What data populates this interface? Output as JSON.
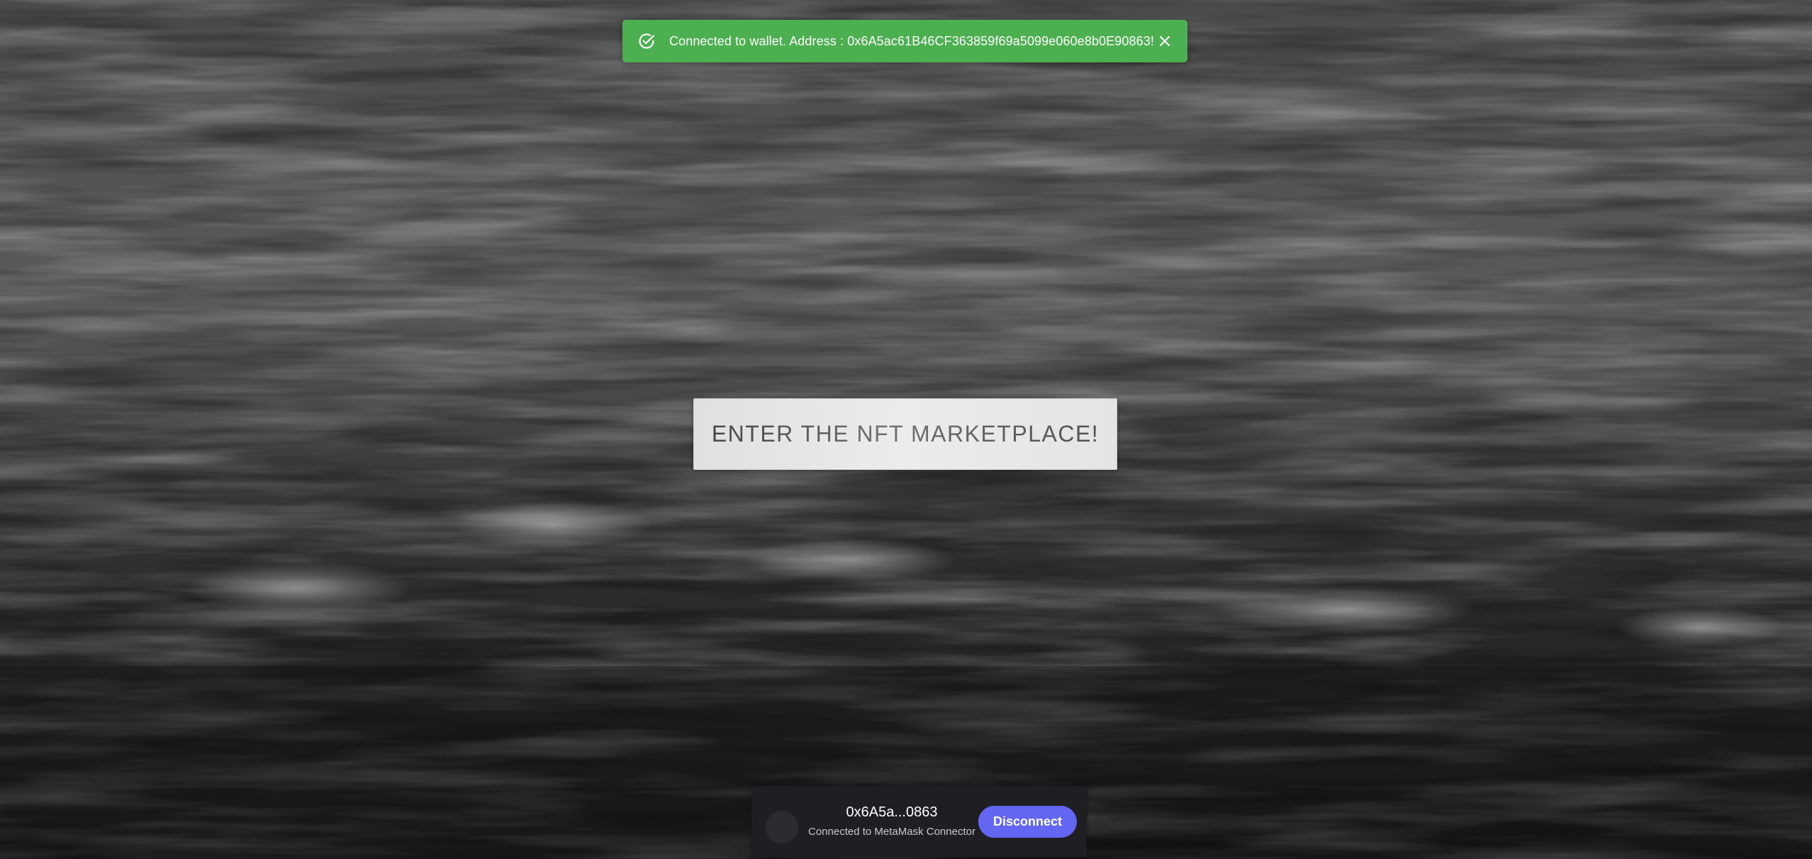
{
  "background": {
    "image_name": "black-and-white-ocean-waves"
  },
  "toast": {
    "type": "success",
    "color": "#4caf50",
    "icon": "check-circle-icon",
    "message": "Connected to wallet. Address : 0x6A5ac61B46CF363859f69a5099e060e8b0E90863!",
    "close_icon": "close-icon"
  },
  "hero": {
    "button_label": "ENTER THE NFT MARKETPLACE!"
  },
  "wallet": {
    "address_short": "0x6A5a...0863",
    "connector": "Connected to MetaMask Connector",
    "disconnect_label": "Disconnect",
    "accent": "#6366f1"
  }
}
